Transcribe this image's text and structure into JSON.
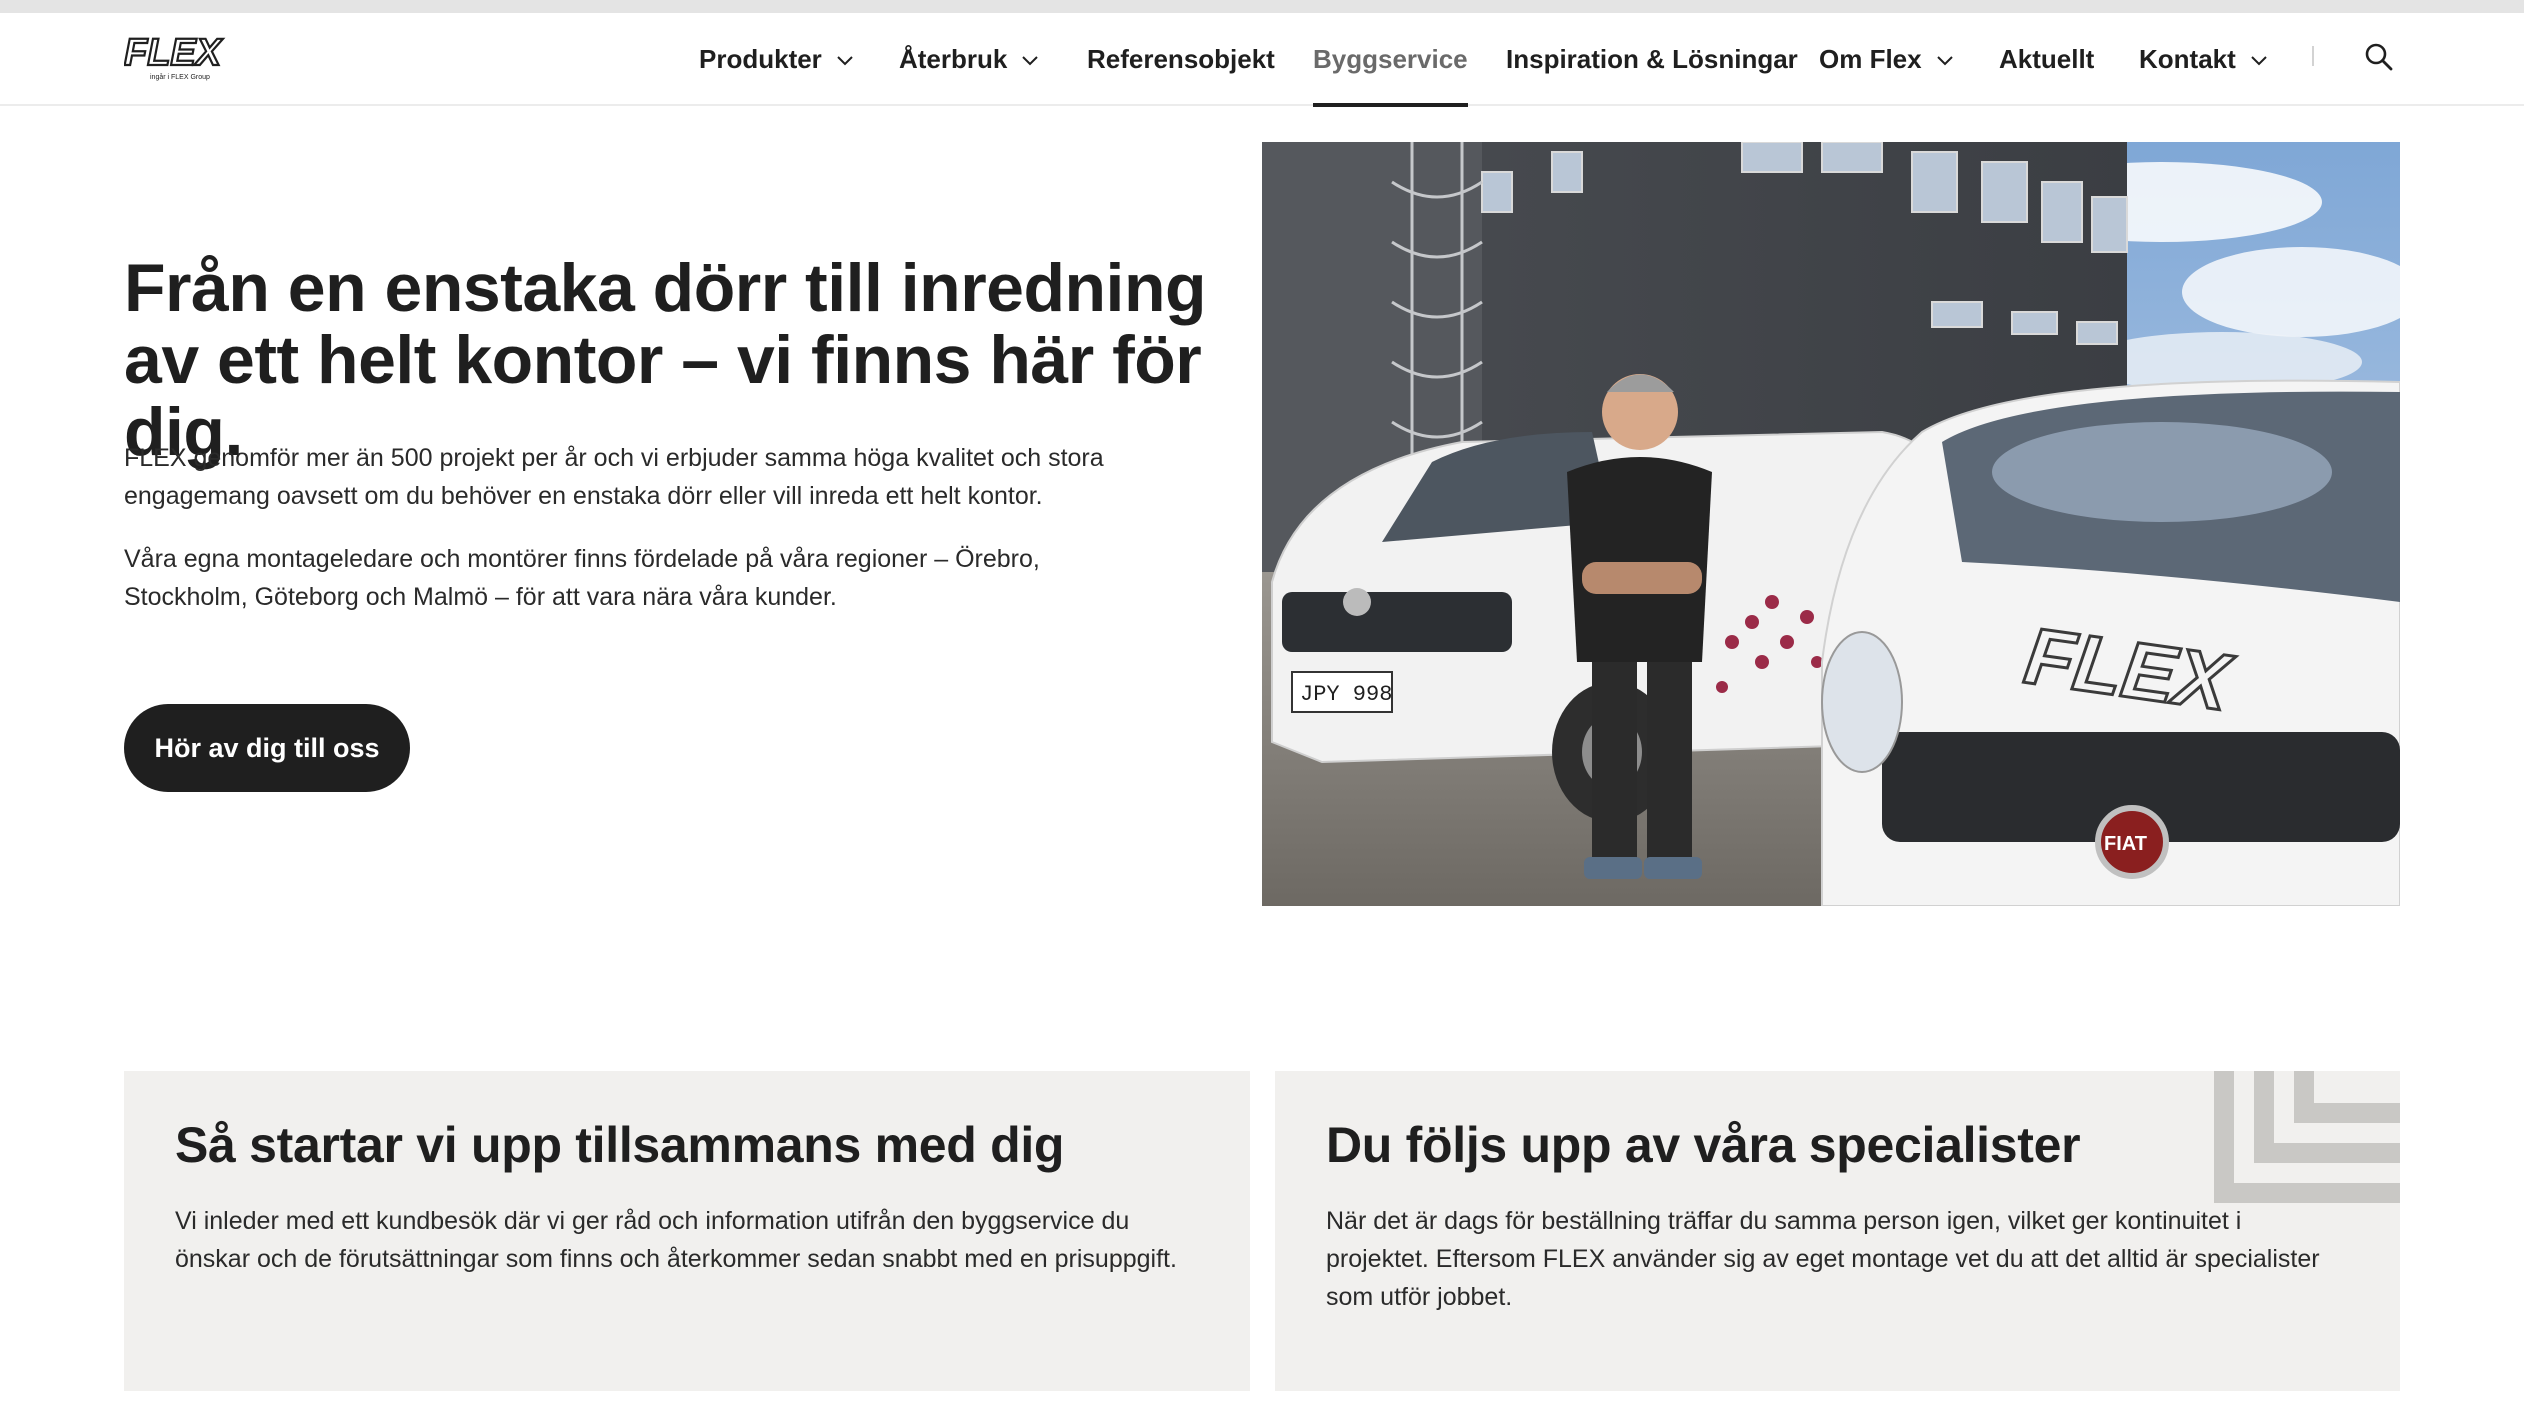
{
  "header": {
    "logo": {
      "text": "FLEX",
      "subtext": "ingår i FLEX Group"
    },
    "nav": [
      {
        "label": "Produkter",
        "dropdown": true
      },
      {
        "label": "Återbruk",
        "dropdown": true
      },
      {
        "label": "Referensobjekt",
        "dropdown": false
      },
      {
        "label": "Byggservice",
        "dropdown": false,
        "active": true
      },
      {
        "label": "Inspiration & Lösningar",
        "dropdown": false
      },
      {
        "label": "Om Flex",
        "dropdown": true
      },
      {
        "label": "Aktuellt",
        "dropdown": false
      },
      {
        "label": "Kontakt",
        "dropdown": true
      }
    ],
    "search_icon": "search-icon"
  },
  "hero": {
    "title": "Från en enstaka dörr till inredning av ett helt kontor – vi finns här för dig.",
    "paragraph1": "FLEX genomför mer än 500 projekt per år och vi erbjuder samma höga kvalitet och stora engagemang oavsett om du behöver en enstaka dörr eller vill inreda ett helt kontor.",
    "paragraph2": "Våra egna montageledare och montörer finns fördelade på våra regioner – Örebro, Stockholm, Göteborg och Malmö – för att vara nära våra kunder.",
    "cta_label": "Hör av dig till oss",
    "photo": {
      "van_brand": "FLEX",
      "license_plate": "JPY 998",
      "car_badge": "FIAT"
    }
  },
  "cards": [
    {
      "title": "Så startar vi upp tillsammans med dig",
      "text": "Vi inleder med ett kundbesök där vi ger råd och information utifrån den byggservice du önskar och de förutsättningar som finns och återkommer sedan snabbt med en prisuppgift."
    },
    {
      "title": "Du följs upp av våra specialister",
      "text": "När det är dags för beställning träffar du samma person igen, vilket ger kontinuitet i projektet. Eftersom FLEX använder sig av eget montage vet du att det alltid är specialister som utför jobbet."
    }
  ],
  "colors": {
    "text": "#1f1f1f",
    "button_bg": "#1f1f1f",
    "card_bg": "#f1f0ee",
    "nav_active": "#6a6a6a"
  }
}
